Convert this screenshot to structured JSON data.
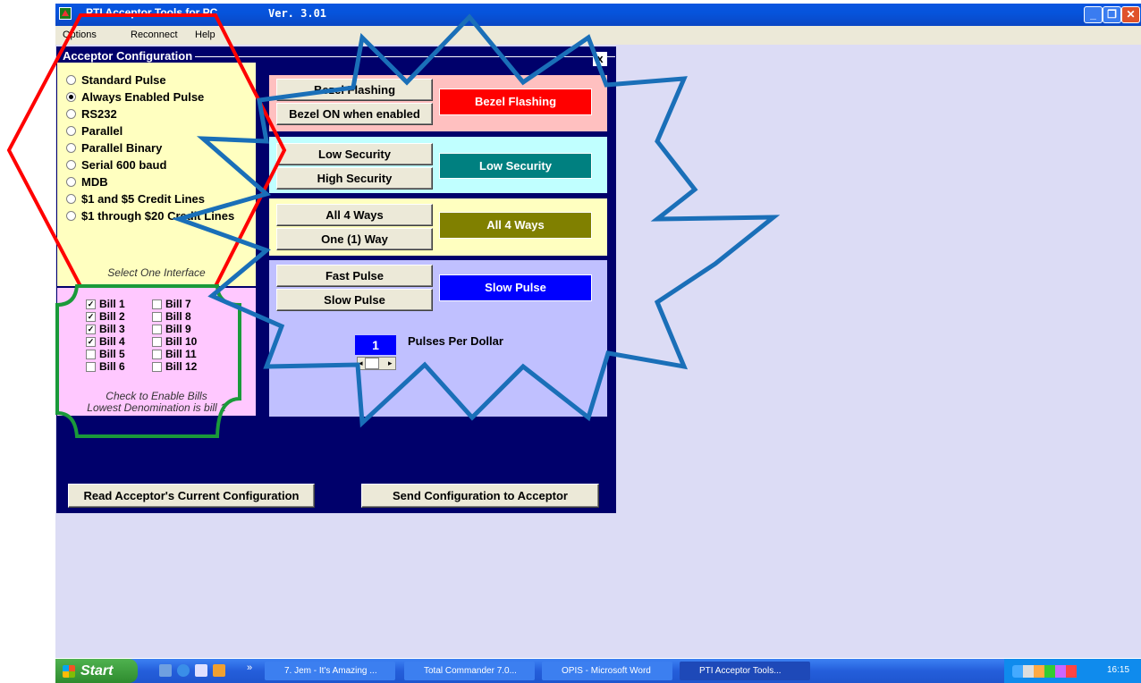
{
  "window": {
    "title": "PTI Acceptor Tools for PC",
    "version": "Ver. 3.01"
  },
  "menu": [
    "Options",
    "Reconnect",
    "Help"
  ],
  "dialog": {
    "title": "Acceptor Configuration",
    "close": "x",
    "interfaces": [
      {
        "label": "Standard Pulse",
        "checked": false
      },
      {
        "label": "Always Enabled Pulse",
        "checked": true
      },
      {
        "label": "RS232",
        "checked": false
      },
      {
        "label": "Parallel",
        "checked": false
      },
      {
        "label": "Parallel Binary",
        "checked": false
      },
      {
        "label": "Serial 600 baud",
        "checked": false
      },
      {
        "label": "MDB",
        "checked": false
      },
      {
        "label": "$1 and $5 Credit Lines",
        "checked": false
      },
      {
        "label": "$1 through $20 Credit Lines",
        "checked": false
      }
    ],
    "interface_note": "Select One Interface",
    "bills_left": [
      {
        "label": "Bill 1",
        "checked": true
      },
      {
        "label": "Bill 2",
        "checked": true
      },
      {
        "label": "Bill 3",
        "checked": true
      },
      {
        "label": "Bill 4",
        "checked": true
      },
      {
        "label": "Bill 5",
        "checked": false
      },
      {
        "label": "Bill 6",
        "checked": false
      }
    ],
    "bills_right": [
      {
        "label": "Bill 7",
        "checked": false
      },
      {
        "label": "Bill 8",
        "checked": false
      },
      {
        "label": "Bill 9",
        "checked": false
      },
      {
        "label": "Bill 10",
        "checked": false
      },
      {
        "label": "Bill 11",
        "checked": false
      },
      {
        "label": "Bill 12",
        "checked": false
      }
    ],
    "bills_note_1": "Check to Enable Bills",
    "bills_note_2": "Lowest Denomination is bill 1",
    "bezel": {
      "btn1": "Bezel Flashing",
      "btn2": "Bezel ON when enabled",
      "status": "Bezel Flashing",
      "bg": "#ffc0c0",
      "status_color": "#ff0000"
    },
    "security": {
      "btn1": "Low Security",
      "btn2": "High Security",
      "status": "Low Security",
      "bg": "#c0ffff",
      "status_color": "#008080"
    },
    "ways": {
      "btn1": "All 4 Ways",
      "btn2": "One (1) Way",
      "status": "All 4 Ways",
      "bg": "#ffffc0",
      "status_color": "#808000"
    },
    "pulse": {
      "btn1": "Fast Pulse",
      "btn2": "Slow Pulse",
      "status": "Slow Pulse",
      "bg": "#c0c0ff",
      "status_color": "#0000ff",
      "pulses_value": "1",
      "pulses_label": "Pulses Per Dollar"
    },
    "read_button": "Read Acceptor's Current Configuration",
    "send_button": "Send Configuration to Acceptor"
  },
  "taskbar": {
    "start": "Start",
    "tasks": [
      "7. Jem - It's Amazing ...",
      "Total Commander 7.0...",
      "OPIS - Microsoft Word",
      "PTI Acceptor Tools..."
    ],
    "clock": "16:15"
  }
}
